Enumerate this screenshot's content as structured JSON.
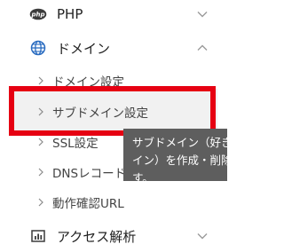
{
  "menu": {
    "php": {
      "label": "PHP",
      "icon": "php-icon"
    },
    "domain": {
      "label": "ドメイン",
      "icon": "globe-icon",
      "expanded": true
    },
    "domain_children": [
      {
        "label": "ドメイン設定"
      },
      {
        "label": "サブドメイン設定",
        "highlighted": true
      },
      {
        "label": "SSL設定"
      },
      {
        "label": "DNSレコード設"
      },
      {
        "label": "動作確認URL"
      }
    ],
    "access": {
      "label": "アクセス解析",
      "icon": "bar-chart-icon"
    }
  },
  "tooltip": {
    "line1": "サブドメイン（好き",
    "line2": "イン）を作成・削除",
    "line3": "す。"
  },
  "colors": {
    "highlight_border": "#e60012",
    "tooltip_bg": "#5e5e5e",
    "accent_blue": "#2a6cc0"
  }
}
